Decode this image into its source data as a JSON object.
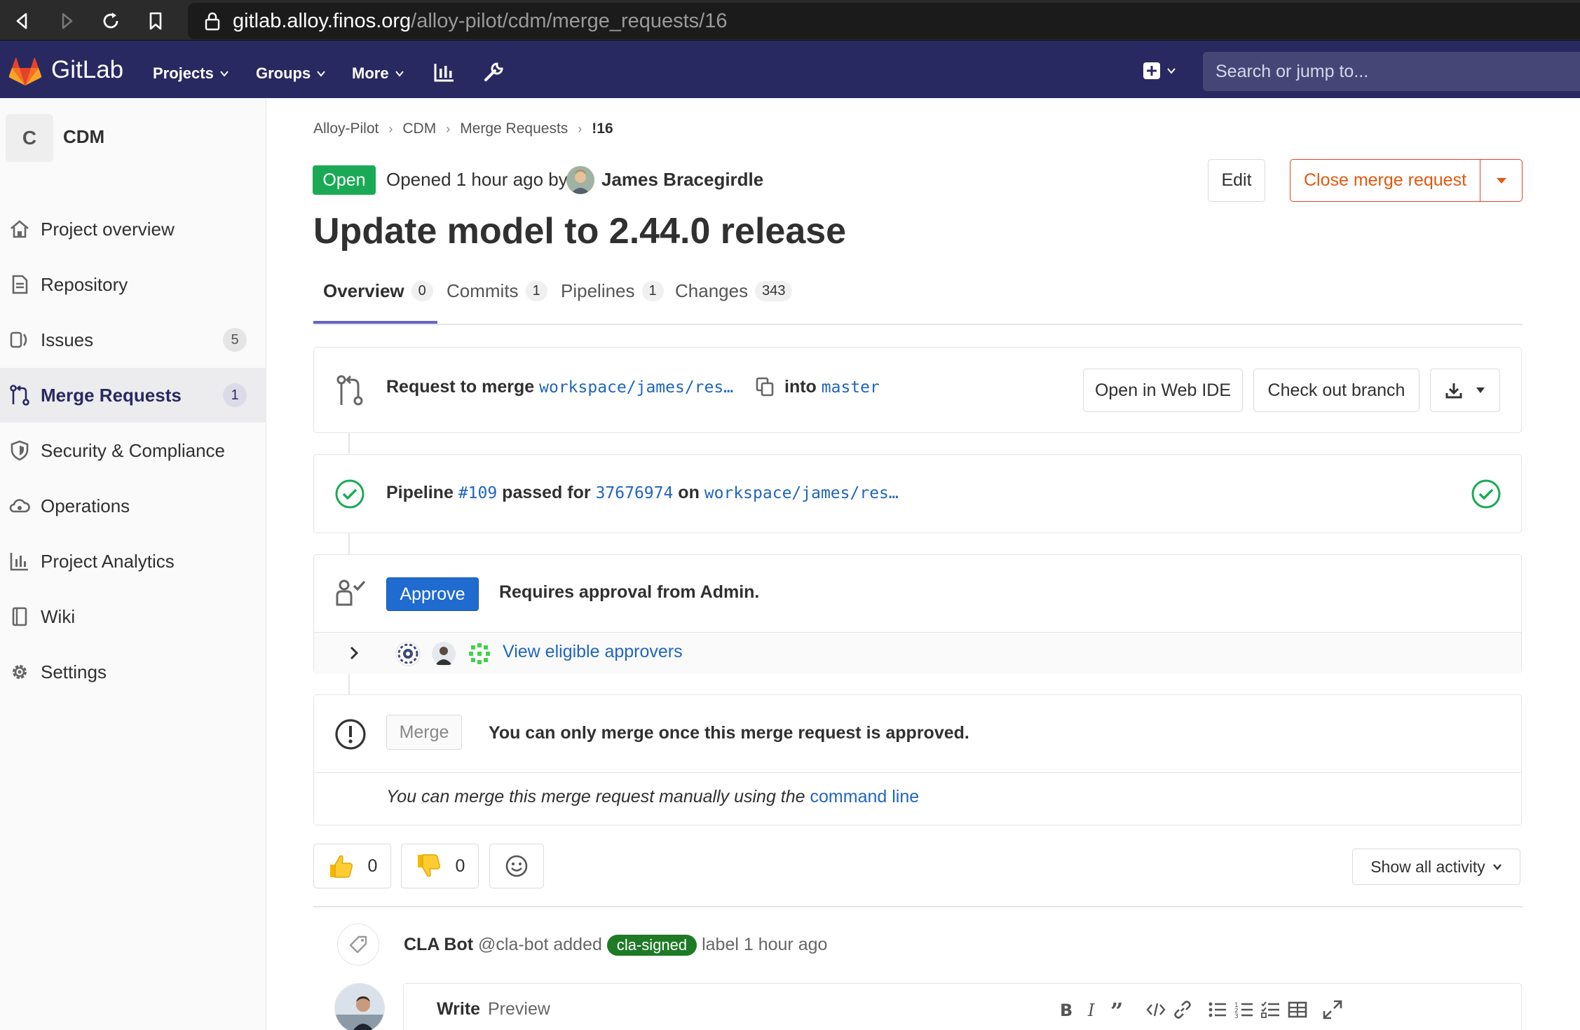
{
  "browser": {
    "url_host": "gitlab.alloy.finos.org",
    "url_path": "/alloy-pilot/cdm/merge_requests/16"
  },
  "topnav": {
    "brand": "GitLab",
    "items": [
      "Projects",
      "Groups",
      "More"
    ],
    "search_placeholder": "Search or jump to..."
  },
  "sidebar": {
    "project_initial": "C",
    "project_name": "CDM",
    "items": [
      {
        "label": "Project overview",
        "icon": "home-icon"
      },
      {
        "label": "Repository",
        "icon": "document-icon"
      },
      {
        "label": "Issues",
        "icon": "issues-icon",
        "count": "5"
      },
      {
        "label": "Merge Requests",
        "icon": "merge-request-icon",
        "count": "1",
        "active": true
      },
      {
        "label": "Security & Compliance",
        "icon": "shield-icon"
      },
      {
        "label": "Operations",
        "icon": "cloud-gear-icon"
      },
      {
        "label": "Project Analytics",
        "icon": "chart-icon"
      },
      {
        "label": "Wiki",
        "icon": "book-icon"
      },
      {
        "label": "Settings",
        "icon": "gear-icon"
      }
    ]
  },
  "breadcrumb": [
    "Alloy-Pilot",
    "CDM",
    "Merge Requests",
    "!16"
  ],
  "header": {
    "status": "Open",
    "opened_text": "Opened 1 hour ago by",
    "author": "James Bracegirdle",
    "edit_label": "Edit",
    "close_label": "Close merge request"
  },
  "title": "Update model to 2.44.0 release",
  "tabs": [
    {
      "label": "Overview",
      "count": "0"
    },
    {
      "label": "Commits",
      "count": "1"
    },
    {
      "label": "Pipelines",
      "count": "1"
    },
    {
      "label": "Changes",
      "count": "343"
    }
  ],
  "merge_info": {
    "prefix": "Request to merge",
    "source_branch": "workspace/james/res…",
    "into": "into",
    "target_branch": "master",
    "web_ide_label": "Open in Web IDE",
    "checkout_label": "Check out branch"
  },
  "pipeline": {
    "prefix": "Pipeline",
    "id": "#109",
    "passed_for": "passed for",
    "commit": "37676974",
    "on": "on",
    "branch": "workspace/james/res…"
  },
  "approval": {
    "button": "Approve",
    "text": "Requires approval from Admin.",
    "view_approvers": "View eligible approvers"
  },
  "merge_block": {
    "button": "Merge",
    "text": "You can only merge once this merge request is approved.",
    "manual_prefix": "You can merge this merge request manually using the",
    "manual_link": "command line"
  },
  "reactions": {
    "thumbs_up": "0",
    "thumbs_down": "0",
    "show_activity": "Show all activity"
  },
  "activity": {
    "user": "CLA Bot",
    "handle": "@cla-bot added",
    "label": "cla-signed",
    "suffix": "label 1 hour ago"
  },
  "editor": {
    "write": "Write",
    "preview": "Preview"
  },
  "colors": {
    "navbar": "#292961",
    "open_green": "#1aaa55",
    "close_orange": "#e2590f",
    "approve_blue": "#1f6bd0",
    "link_blue": "#1f65c1",
    "label_green": "#1f7a26"
  }
}
